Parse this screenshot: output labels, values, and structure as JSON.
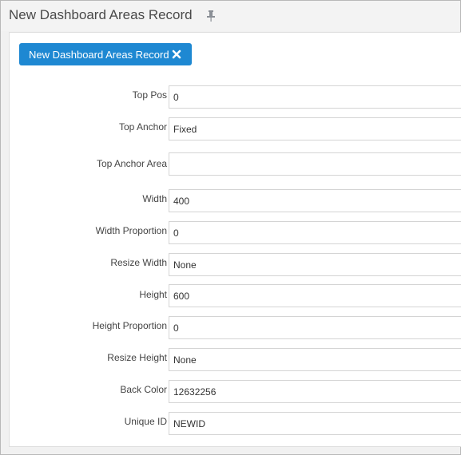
{
  "header": {
    "title": "New Dashboard Areas Record",
    "pin_icon": "pin-icon"
  },
  "tab": {
    "label": "New Dashboard Areas Record",
    "close_icon": "close-icon"
  },
  "form": {
    "fields": [
      {
        "label": "Top Pos",
        "value": "0"
      },
      {
        "label": "Top Anchor",
        "value": "Fixed"
      },
      {
        "label": "Top Anchor Area",
        "value": ""
      },
      {
        "label": "Width",
        "value": "400"
      },
      {
        "label": "Width Proportion",
        "value": "0"
      },
      {
        "label": "Resize Width",
        "value": "None"
      },
      {
        "label": "Height",
        "value": "600"
      },
      {
        "label": "Height Proportion",
        "value": "0"
      },
      {
        "label": "Resize Height",
        "value": "None"
      },
      {
        "label": "Back Color",
        "value": "12632256"
      },
      {
        "label": "Unique ID",
        "value": "NEWID"
      }
    ]
  },
  "colors": {
    "accent": "#1e88d2",
    "background": "#f1f1f1"
  }
}
